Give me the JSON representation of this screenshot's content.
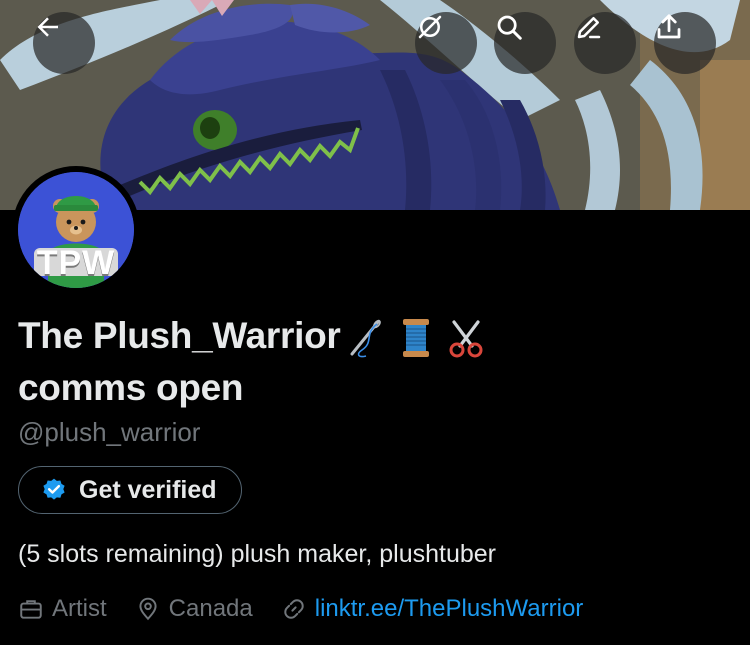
{
  "header": {
    "back_icon": "arrow-left-icon",
    "grok_icon": "grok-icon",
    "search_icon": "search-icon",
    "edit_icon": "pencil-icon",
    "share_icon": "share-icon"
  },
  "profile": {
    "display_name": "The Plush_Warrior",
    "display_name_line2": "comms open",
    "name_emojis": [
      "needle-icon",
      "thread-spool-icon",
      "scissors-icon"
    ],
    "handle": "@plush_warrior",
    "avatar_text": "TPW",
    "verify_label": "Get verified",
    "bio": "(5 slots remaining) plush maker, plushtuber",
    "profession": "Artist",
    "location": "Canada",
    "website": "linktr.ee/ThePlushWarrior"
  },
  "colors": {
    "background": "#000000",
    "text_primary": "#e7e9ea",
    "text_secondary": "#71767b",
    "link": "#1d9bf0",
    "verified_badge": "#1d9bf0",
    "border": "#536471"
  }
}
